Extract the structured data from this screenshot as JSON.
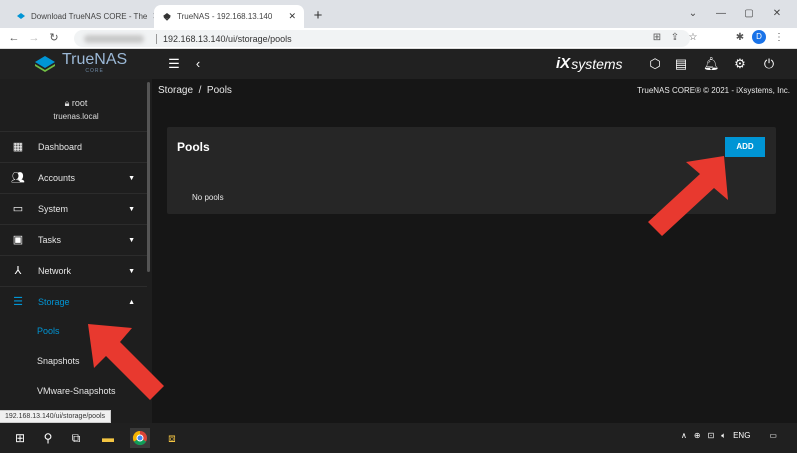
{
  "browser": {
    "tabs": [
      {
        "title": "Download TrueNAS CORE - The",
        "active": false
      },
      {
        "title": "TrueNAS - 192.168.13.140",
        "active": true
      }
    ],
    "url": "192.168.13.140/ui/storage/pools",
    "profile_initial": "D",
    "status_url": "192.168.13.140/ui/storage/pools"
  },
  "app": {
    "logo": "TrueNAS",
    "logo_sub": "CORE",
    "vendor_ix": "iX",
    "vendor_systems": "systems",
    "user": "root",
    "host": "truenas.local",
    "breadcrumb": "Storage  /  Pools",
    "copyright": "TrueNAS CORE® © 2021 - iXsystems, Inc."
  },
  "sidebar": {
    "items": [
      {
        "label": "Dashboard",
        "icon": "dashboard-icon",
        "expandable": false
      },
      {
        "label": "Accounts",
        "icon": "people-icon",
        "expandable": true
      },
      {
        "label": "System",
        "icon": "laptop-icon",
        "expandable": true
      },
      {
        "label": "Tasks",
        "icon": "calendar-icon",
        "expandable": true
      },
      {
        "label": "Network",
        "icon": "network-icon",
        "expandable": true
      },
      {
        "label": "Storage",
        "icon": "storage-icon",
        "expandable": true,
        "active": true
      }
    ],
    "sub_items": [
      {
        "label": "Pools",
        "active": true
      },
      {
        "label": "Snapshots"
      },
      {
        "label": "VMware-Snapshots"
      }
    ]
  },
  "main": {
    "card_title": "Pools",
    "add_label": "ADD",
    "empty_text": "No pools"
  },
  "taskbar": {
    "language": "ENG"
  },
  "colors": {
    "accent": "#0095d5",
    "topbar": "#212121",
    "sidebar": "#1e1e1e",
    "content": "#161616",
    "card": "#262626",
    "annotation_arrow": "#e8392f"
  }
}
